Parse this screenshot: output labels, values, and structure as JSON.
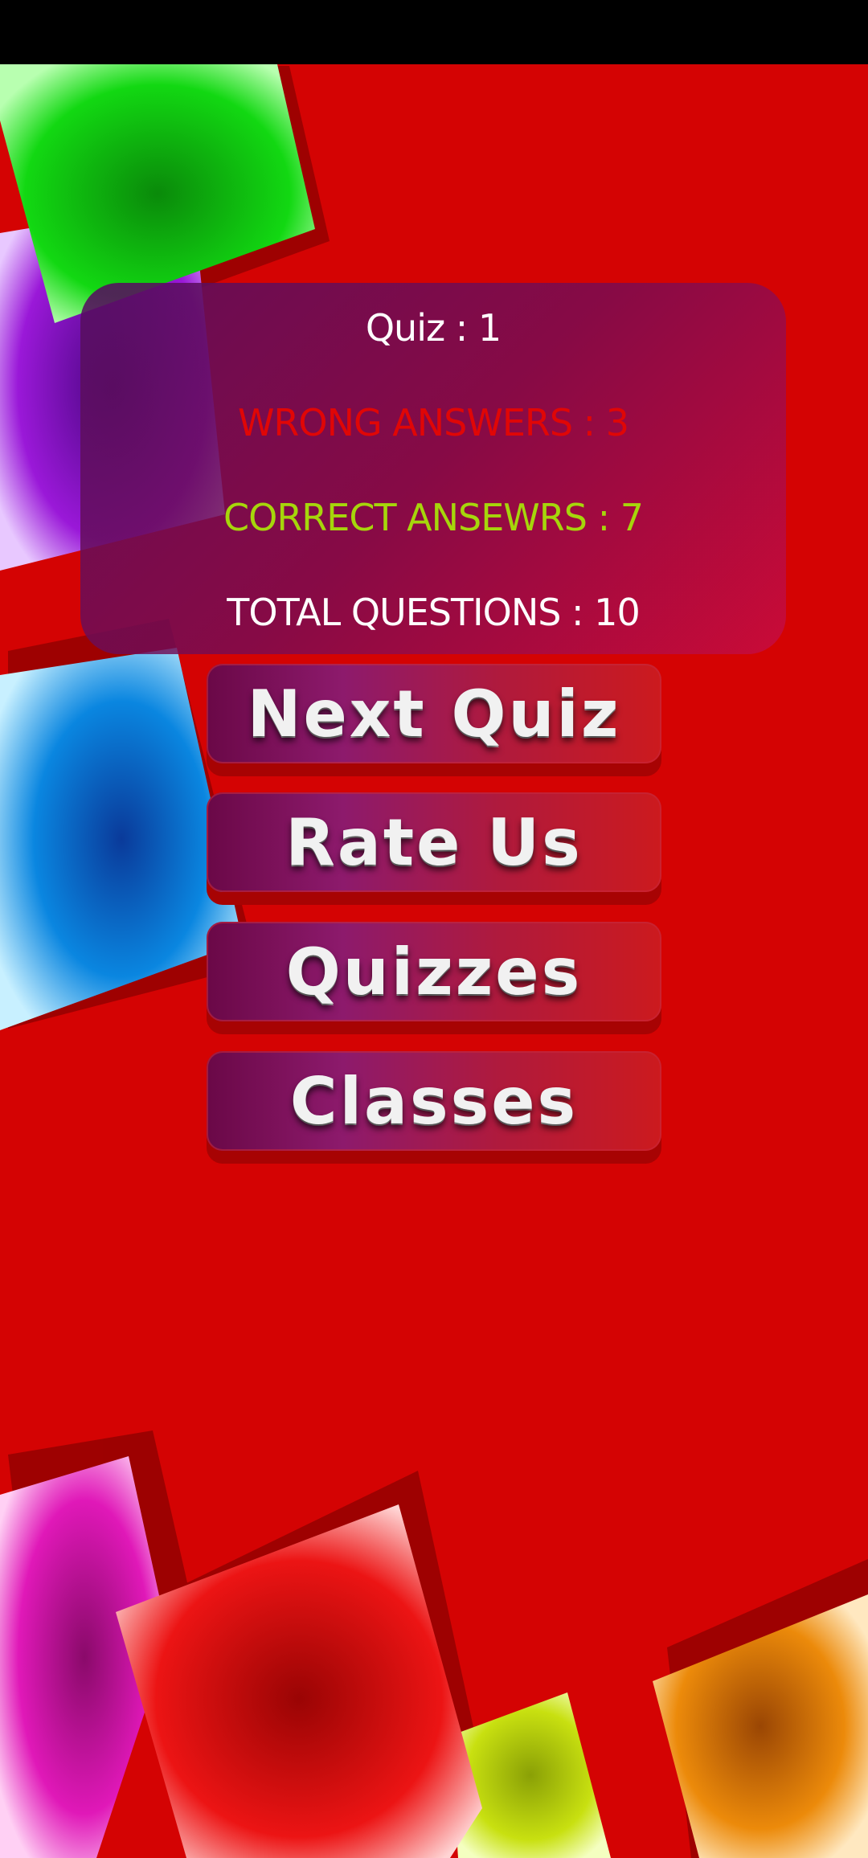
{
  "results": {
    "quiz_label": "Quiz : 1",
    "wrong_answers": "WRONG ANSWERS : 3",
    "correct_answers": "CORRECT ANSEWRS : 7",
    "total_questions": "TOTAL QUESTIONS : 10"
  },
  "menu": {
    "next_quiz": "Next Quiz",
    "rate_us": "Rate Us",
    "quizzes": "Quizzes",
    "classes": "Classes"
  },
  "colors": {
    "background": "#d40303",
    "wrong": "#e00606",
    "correct": "#a6d60b",
    "text": "#ffffff"
  },
  "decorations": [
    "green-tile",
    "purple-tile",
    "blue-tile",
    "magenta-tile",
    "red-tile",
    "lime-tile",
    "orange-tile"
  ]
}
